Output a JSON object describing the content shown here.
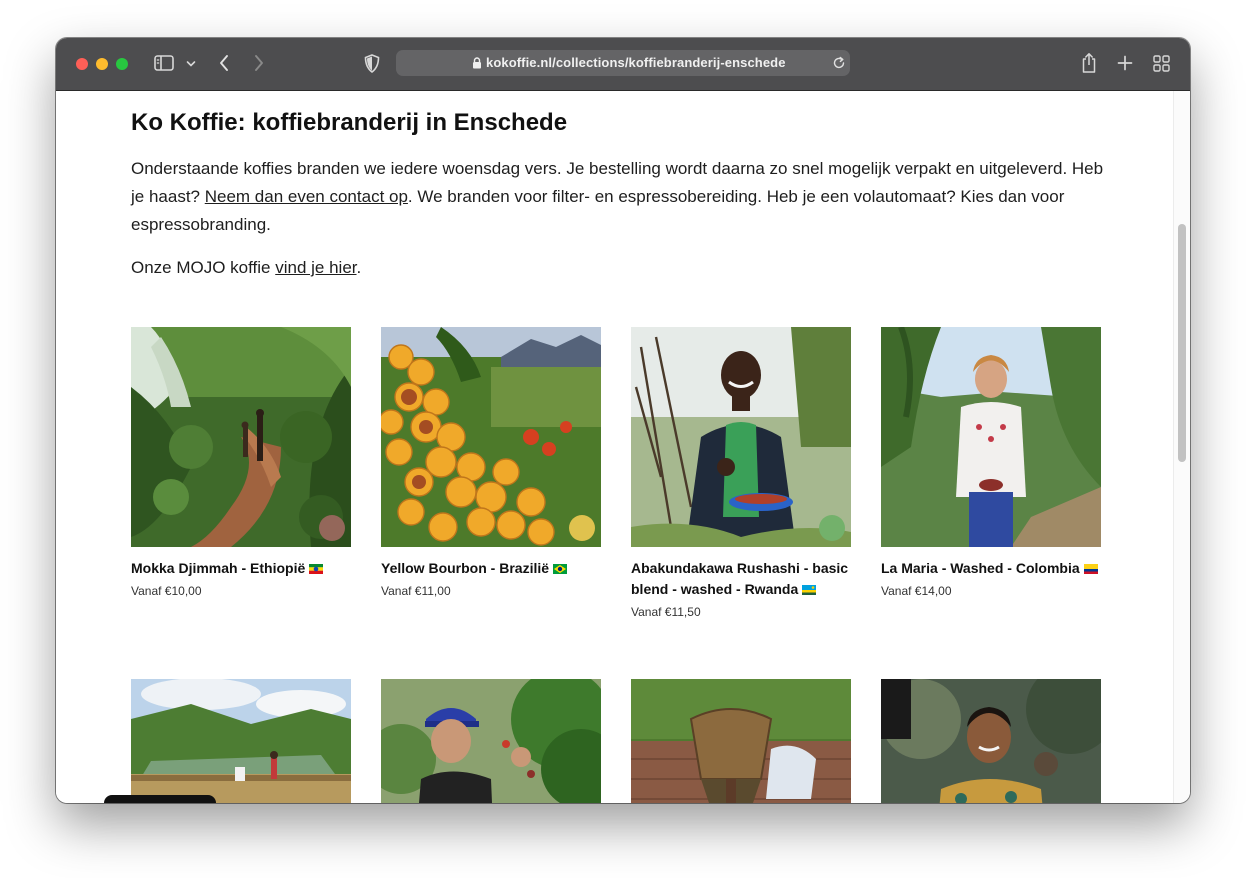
{
  "browser": {
    "url": "kokoffie.nl/collections/koffiebranderij-enschede"
  },
  "page": {
    "title": "Ko Koffie: koffiebranderij in Enschede",
    "intro_part1": "Onderstaande koffies branden we iedere woensdag vers. Je bestelling wordt daarna zo snel mogelijk verpakt en uitgeleverd. Heb je haast? ",
    "intro_link": "Neem dan even contact op",
    "intro_part2": ". We branden voor filter- en espressobereiding. Heb je een volautomaat? Kies dan voor espressobranding.",
    "mojo_prefix": "Onze MOJO koffie ",
    "mojo_link": "vind je hier",
    "mojo_suffix": "."
  },
  "products": [
    {
      "title": "Mokka Djimmah - Ethiopië",
      "price": "Vanaf €10,00",
      "swatch": "#94675a",
      "flag": "ethiopia"
    },
    {
      "title": "Yellow Bourbon - Brazilië",
      "price": "Vanaf €11,00",
      "swatch": "#e0c24e",
      "flag": "brazil"
    },
    {
      "title": "Abakundakawa Rushashi - basic blend - washed - Rwanda",
      "price": "Vanaf €11,50",
      "swatch": "#73b16b",
      "flag": "rwanda"
    },
    {
      "title": "La Maria - Washed - Colombia",
      "price": "Vanaf €14,00",
      "swatch": null,
      "flag": "colombia"
    }
  ],
  "row2_images": [
    "drying-beds-landscape",
    "woman-picking-cherries",
    "basket-pouring-beans",
    "smiling-boy"
  ]
}
